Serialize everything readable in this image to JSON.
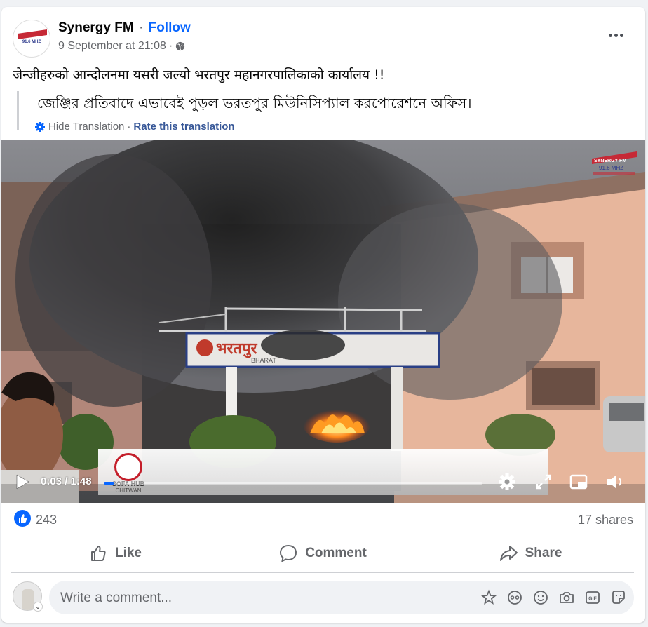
{
  "post": {
    "page_name": "Synergy FM",
    "separator": "·",
    "follow_label": "Follow",
    "timestamp": "9 September at 21:08",
    "meta_separator": "·",
    "text": "जेन्जीहरुको आन्दोलनमा यसरी जल्यो भरतपुर महानगरपालिकाको कार्यालय !!",
    "translation_text": "জেঞ্জির প্রতিবাদে এভাবেই পুড়ল ভরতপুর মিউনিসিপ্যাল করপোরেশনে অফিস।",
    "hide_translation_label": "Hide Translation",
    "translation_separator": "·",
    "rate_translation_label": "Rate this translation",
    "avatar_text": "91.6 MHZ"
  },
  "video": {
    "current_time": "0:03",
    "duration": "1:48",
    "time_display": "0:03 / 1:48",
    "progress_fraction": 0.028,
    "watermark_line1": "SYNERGY FM",
    "watermark_line2": "91.6 MHZ",
    "sign_text": "भरतपुर",
    "sign_sub": "BHARAT",
    "overlay_logo_line1": "SOFA HUB",
    "overlay_logo_line2": "CHITWAN"
  },
  "stats": {
    "reactions_count": "243",
    "shares_label": "17 shares"
  },
  "actions": {
    "like_label": "Like",
    "comment_label": "Comment",
    "share_label": "Share"
  },
  "comment_box": {
    "placeholder": "Write a comment..."
  },
  "colors": {
    "brand_blue": "#0866ff",
    "text_secondary": "#65676b"
  }
}
